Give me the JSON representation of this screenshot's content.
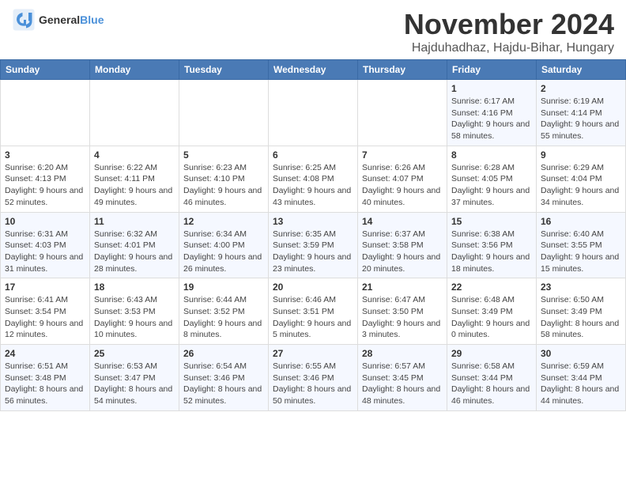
{
  "header": {
    "logo_general": "General",
    "logo_blue": "Blue",
    "month": "November 2024",
    "location": "Hajduhadhaz, Hajdu-Bihar, Hungary"
  },
  "days_of_week": [
    "Sunday",
    "Monday",
    "Tuesday",
    "Wednesday",
    "Thursday",
    "Friday",
    "Saturday"
  ],
  "weeks": [
    [
      {
        "day": "",
        "info": ""
      },
      {
        "day": "",
        "info": ""
      },
      {
        "day": "",
        "info": ""
      },
      {
        "day": "",
        "info": ""
      },
      {
        "day": "",
        "info": ""
      },
      {
        "day": "1",
        "info": "Sunrise: 6:17 AM\nSunset: 4:16 PM\nDaylight: 9 hours and 58 minutes."
      },
      {
        "day": "2",
        "info": "Sunrise: 6:19 AM\nSunset: 4:14 PM\nDaylight: 9 hours and 55 minutes."
      }
    ],
    [
      {
        "day": "3",
        "info": "Sunrise: 6:20 AM\nSunset: 4:13 PM\nDaylight: 9 hours and 52 minutes."
      },
      {
        "day": "4",
        "info": "Sunrise: 6:22 AM\nSunset: 4:11 PM\nDaylight: 9 hours and 49 minutes."
      },
      {
        "day": "5",
        "info": "Sunrise: 6:23 AM\nSunset: 4:10 PM\nDaylight: 9 hours and 46 minutes."
      },
      {
        "day": "6",
        "info": "Sunrise: 6:25 AM\nSunset: 4:08 PM\nDaylight: 9 hours and 43 minutes."
      },
      {
        "day": "7",
        "info": "Sunrise: 6:26 AM\nSunset: 4:07 PM\nDaylight: 9 hours and 40 minutes."
      },
      {
        "day": "8",
        "info": "Sunrise: 6:28 AM\nSunset: 4:05 PM\nDaylight: 9 hours and 37 minutes."
      },
      {
        "day": "9",
        "info": "Sunrise: 6:29 AM\nSunset: 4:04 PM\nDaylight: 9 hours and 34 minutes."
      }
    ],
    [
      {
        "day": "10",
        "info": "Sunrise: 6:31 AM\nSunset: 4:03 PM\nDaylight: 9 hours and 31 minutes."
      },
      {
        "day": "11",
        "info": "Sunrise: 6:32 AM\nSunset: 4:01 PM\nDaylight: 9 hours and 28 minutes."
      },
      {
        "day": "12",
        "info": "Sunrise: 6:34 AM\nSunset: 4:00 PM\nDaylight: 9 hours and 26 minutes."
      },
      {
        "day": "13",
        "info": "Sunrise: 6:35 AM\nSunset: 3:59 PM\nDaylight: 9 hours and 23 minutes."
      },
      {
        "day": "14",
        "info": "Sunrise: 6:37 AM\nSunset: 3:58 PM\nDaylight: 9 hours and 20 minutes."
      },
      {
        "day": "15",
        "info": "Sunrise: 6:38 AM\nSunset: 3:56 PM\nDaylight: 9 hours and 18 minutes."
      },
      {
        "day": "16",
        "info": "Sunrise: 6:40 AM\nSunset: 3:55 PM\nDaylight: 9 hours and 15 minutes."
      }
    ],
    [
      {
        "day": "17",
        "info": "Sunrise: 6:41 AM\nSunset: 3:54 PM\nDaylight: 9 hours and 12 minutes."
      },
      {
        "day": "18",
        "info": "Sunrise: 6:43 AM\nSunset: 3:53 PM\nDaylight: 9 hours and 10 minutes."
      },
      {
        "day": "19",
        "info": "Sunrise: 6:44 AM\nSunset: 3:52 PM\nDaylight: 9 hours and 8 minutes."
      },
      {
        "day": "20",
        "info": "Sunrise: 6:46 AM\nSunset: 3:51 PM\nDaylight: 9 hours and 5 minutes."
      },
      {
        "day": "21",
        "info": "Sunrise: 6:47 AM\nSunset: 3:50 PM\nDaylight: 9 hours and 3 minutes."
      },
      {
        "day": "22",
        "info": "Sunrise: 6:48 AM\nSunset: 3:49 PM\nDaylight: 9 hours and 0 minutes."
      },
      {
        "day": "23",
        "info": "Sunrise: 6:50 AM\nSunset: 3:49 PM\nDaylight: 8 hours and 58 minutes."
      }
    ],
    [
      {
        "day": "24",
        "info": "Sunrise: 6:51 AM\nSunset: 3:48 PM\nDaylight: 8 hours and 56 minutes."
      },
      {
        "day": "25",
        "info": "Sunrise: 6:53 AM\nSunset: 3:47 PM\nDaylight: 8 hours and 54 minutes."
      },
      {
        "day": "26",
        "info": "Sunrise: 6:54 AM\nSunset: 3:46 PM\nDaylight: 8 hours and 52 minutes."
      },
      {
        "day": "27",
        "info": "Sunrise: 6:55 AM\nSunset: 3:46 PM\nDaylight: 8 hours and 50 minutes."
      },
      {
        "day": "28",
        "info": "Sunrise: 6:57 AM\nSunset: 3:45 PM\nDaylight: 8 hours and 48 minutes."
      },
      {
        "day": "29",
        "info": "Sunrise: 6:58 AM\nSunset: 3:44 PM\nDaylight: 8 hours and 46 minutes."
      },
      {
        "day": "30",
        "info": "Sunrise: 6:59 AM\nSunset: 3:44 PM\nDaylight: 8 hours and 44 minutes."
      }
    ]
  ]
}
